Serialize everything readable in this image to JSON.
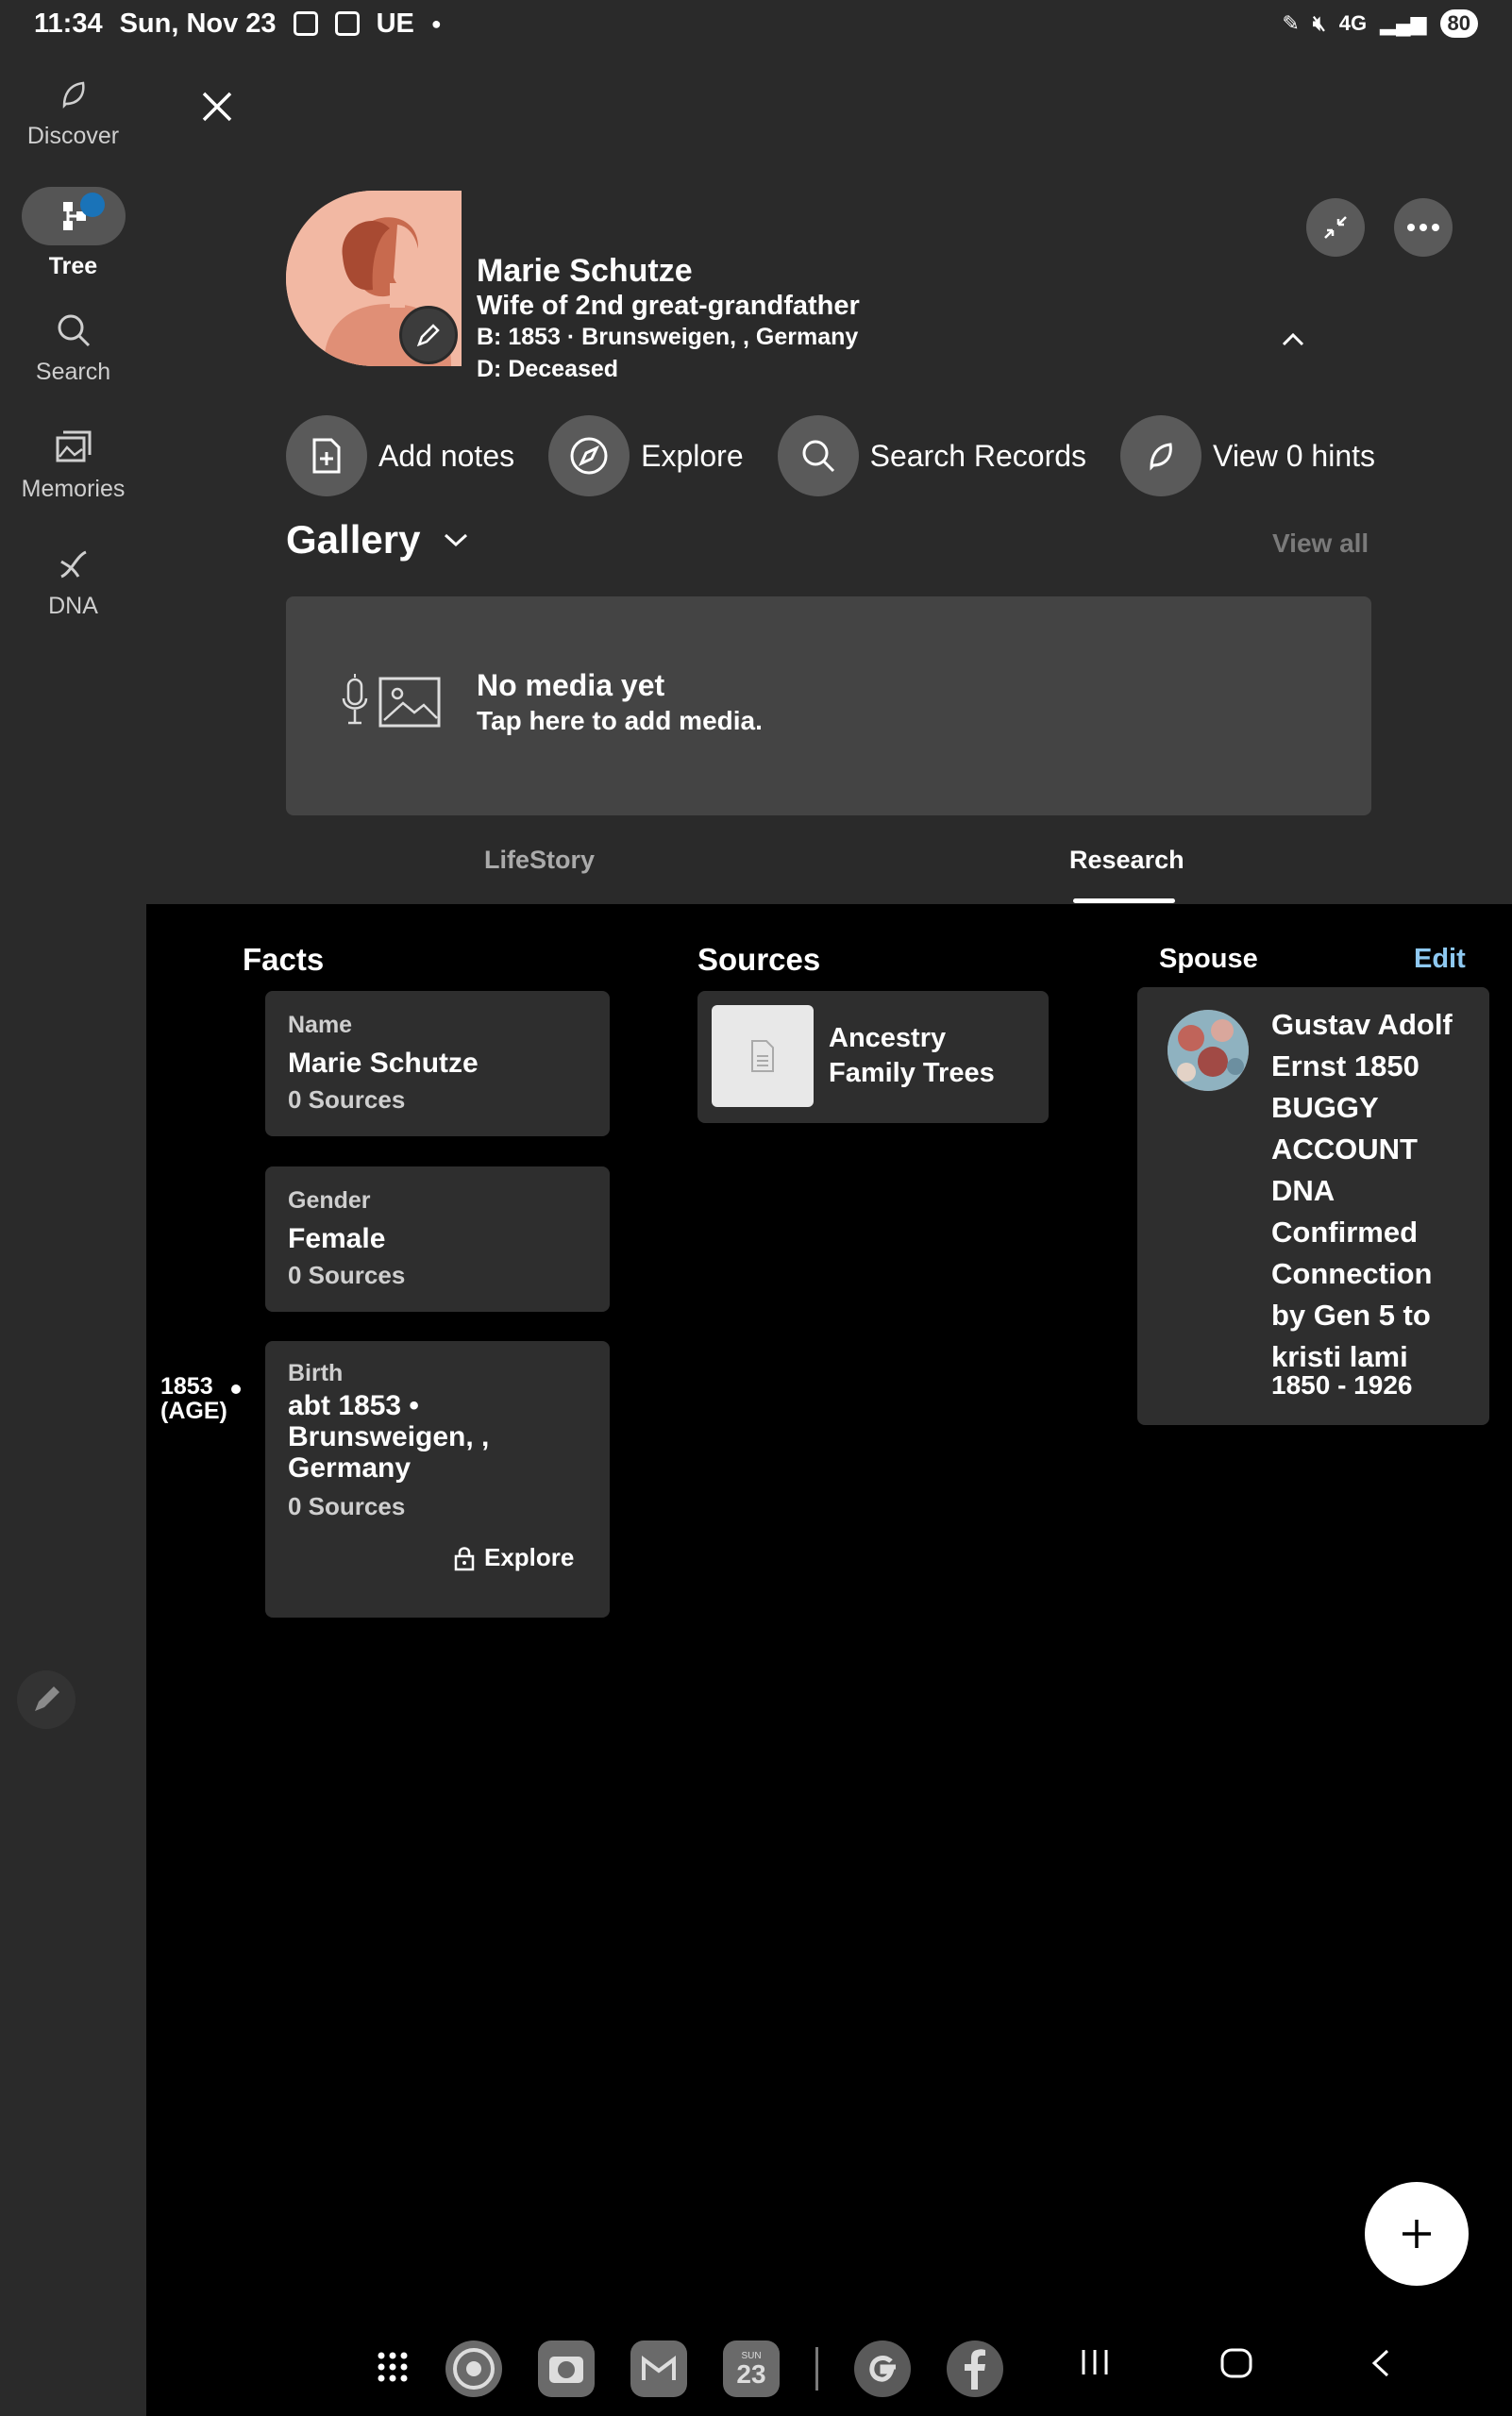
{
  "status_bar": {
    "time": "11:34",
    "date": "Sun, Nov 23",
    "carrier_tag": "UE",
    "network": "4G",
    "battery": "80"
  },
  "rail": {
    "items": [
      {
        "label": "Discover",
        "icon": "discover-icon"
      },
      {
        "label": "Tree",
        "icon": "tree-icon"
      },
      {
        "label": "Search",
        "icon": "search-icon"
      },
      {
        "label": "Memories",
        "icon": "memories-icon"
      },
      {
        "label": "DNA",
        "icon": "dna-icon"
      }
    ],
    "active": "Tree"
  },
  "person": {
    "name": "Marie Schutze",
    "relationship": "Wife of 2nd great-grandfather",
    "birth": "B: 1853 · Brunsweigen, , Germany",
    "death": "D: Deceased"
  },
  "actions": [
    {
      "label": "Add notes",
      "icon": "add-note-icon"
    },
    {
      "label": "Explore",
      "icon": "compass-icon"
    },
    {
      "label": "Search Records",
      "icon": "search-icon"
    },
    {
      "label": "View 0 hints",
      "icon": "hint-leaf-icon"
    }
  ],
  "gallery": {
    "title": "Gallery",
    "view_all": "View all",
    "empty_title": "No media yet",
    "empty_subtitle": "Tap here to add media."
  },
  "tabs": {
    "lifestory": "LifeStory",
    "research": "Research",
    "selected": "Research"
  },
  "facts": {
    "heading": "Facts",
    "name_card": {
      "label": "Name",
      "value": "Marie Schutze",
      "sources": "0 Sources"
    },
    "gender_card": {
      "label": "Gender",
      "value": "Female",
      "sources": "0 Sources"
    },
    "birth_card": {
      "label": "Birth",
      "value": "abt 1853 • Brunsweigen, , Germany",
      "sources": "0 Sources",
      "explore": "Explore"
    },
    "timeline_year": "1853",
    "timeline_age": "(AGE)"
  },
  "sources": {
    "heading": "Sources",
    "items": [
      {
        "title": "Ancestry Family Trees"
      }
    ]
  },
  "spouse": {
    "heading": "Spouse",
    "edit": "Edit",
    "name": "Gustav Adolf Ernst 1850 BUGGY ACCOUNT DNA Confirmed Connection by Gen 5 to kristi lami",
    "dates": "1850 - 1926"
  },
  "dock": {
    "calendar_day": "23",
    "calendar_weekday": "SUN"
  },
  "colors": {
    "panel": "#2a2a2a",
    "card": "#2e2e2e",
    "accent_link": "#8ec9f2",
    "hint_dot": "#1a73b8"
  }
}
